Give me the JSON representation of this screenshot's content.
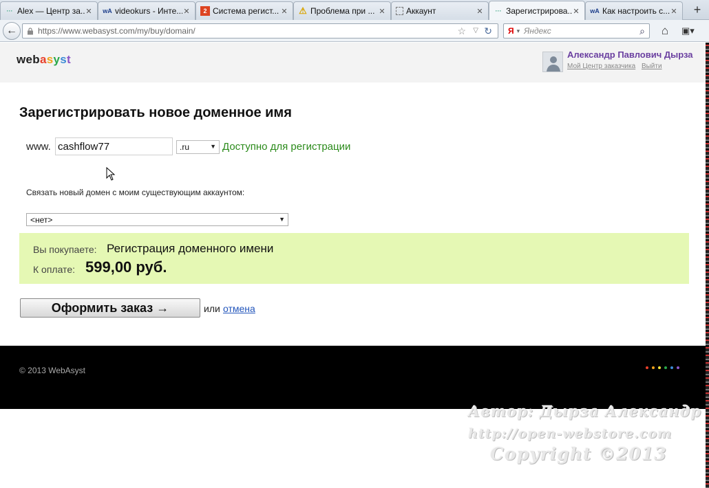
{
  "browser": {
    "tabs": [
      {
        "label": "Alex — Центр за...",
        "icon": "dots-icon"
      },
      {
        "label": "videokurs - Инте...",
        "icon": "webasyst-icon"
      },
      {
        "label": "Система регист...",
        "icon": "red-2-icon"
      },
      {
        "label": "Проблема при ...",
        "icon": "warning-icon"
      },
      {
        "label": "Аккаунт",
        "icon": "blank-page-icon"
      },
      {
        "label": "Зарегистрирова...",
        "icon": "dots-icon",
        "active": true
      },
      {
        "label": "Как настроить с...",
        "icon": "webasyst-icon"
      }
    ],
    "new_tab": "+",
    "url": "https://www.webasyst.com/my/buy/domain/",
    "search_engine": "Я",
    "search_placeholder": "Яндекс"
  },
  "header": {
    "logo": [
      "web",
      "a",
      "s",
      "y",
      "s",
      "t"
    ],
    "logo_colors": [
      "#222222",
      "#e8402b",
      "#f0a21b",
      "#2aa84a",
      "#3c8bd6",
      "#8a56c6"
    ],
    "user_name": "Александр Павлович Дырза",
    "links": [
      "Мой Центр заказчика",
      "Выйти"
    ]
  },
  "main": {
    "title": "Зарегистрировать новое доменное имя",
    "www_prefix": "www.",
    "domain_value": "cashflow77",
    "tld": ".ru",
    "availability": "Доступно для регистрации",
    "link_account_label": "Связать новый домен с моим существующим аккаунтом:",
    "account_selected": "<нет>",
    "summary": {
      "buying_label": "Вы покупаете:",
      "buying_value": "Регистрация доменного имени",
      "pay_label": "К оплате:",
      "pay_value": "599,00 руб."
    },
    "order_button": "Оформить заказ →",
    "or_text": "или",
    "cancel_link": "отмена"
  },
  "footer": {
    "copyright": "© 2013 WebAsyst",
    "dot_colors": [
      "#e8402b",
      "#f0a21b",
      "#f5e23a",
      "#2aa84a",
      "#3c8bd6",
      "#8a56c6"
    ]
  },
  "watermark": {
    "line1": "Автор: Дырза Александр",
    "line2": "http://open-webstore.com",
    "line3": "Copyright ©2013"
  }
}
